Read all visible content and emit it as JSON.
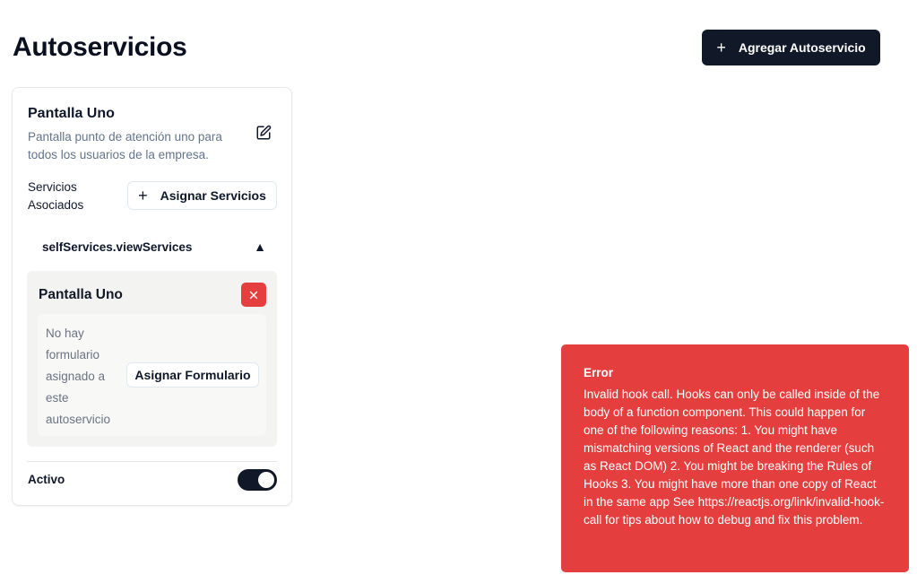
{
  "header": {
    "title": "Autoservicios",
    "add_button_label": "Agregar Autoservicio"
  },
  "card": {
    "title": "Pantalla Uno",
    "description": "Pantalla punto de atención uno para todos los usuarios de la empresa.",
    "services_label": "Servicios Asociados",
    "assign_services_label": "Asignar Servicios",
    "collapsible_label": "selfServices.viewServices",
    "collapsible_indicator": "▲",
    "service": {
      "title": "Pantalla Uno",
      "empty_form_text": "No hay formulario asignado a este autoservicio",
      "assign_form_label": "Asignar Formulario"
    },
    "active_label": "Activo",
    "active": true
  },
  "toast": {
    "title": "Error",
    "message": "Invalid hook call. Hooks can only be called inside of the body of a function component. This could happen for one of the following reasons: 1. You might have mismatching versions of React and the renderer (such as React DOM) 2. You might be breaking the Rules of Hooks 3. You might have more than one copy of React in the same app See https://reactjs.org/link/invalid-hook-call for tips about how to debug and fix this problem."
  },
  "colors": {
    "primary": "#111827",
    "danger": "#e53e3e",
    "muted_text": "#64748b"
  },
  "icons": [
    "plus-icon",
    "edit-icon",
    "chevron-up-icon",
    "close-icon"
  ]
}
